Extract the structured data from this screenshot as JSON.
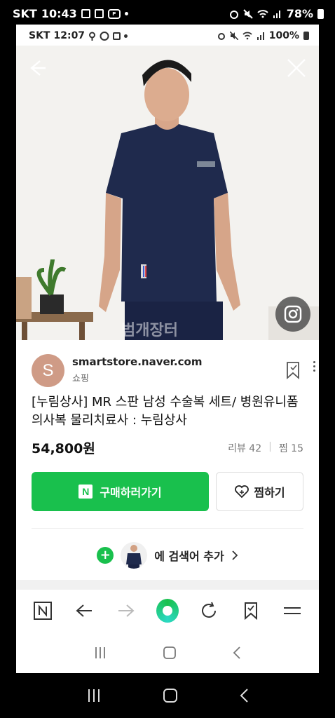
{
  "outer_status": {
    "carrier": "SKT",
    "time": "10:43",
    "battery": "78%"
  },
  "inner_status": {
    "carrier": "SKT",
    "time": "12:07",
    "battery": "100%"
  },
  "photo": {
    "watermark": "범개장터"
  },
  "seller": {
    "avatar_letter": "S",
    "domain": "smartstore.naver.com",
    "category": "쇼핑"
  },
  "product": {
    "title": "[누림상사] MR 스판 남성 수술복 세트/ 병원유니폼 의사복 물리치료사 : 누림상사",
    "price": "54,800원",
    "reviews": "리뷰 42",
    "wishes": "찜 15"
  },
  "actions": {
    "buy_badge": "N",
    "buy_label": "구매하러가기",
    "wish_label": "찜하기"
  },
  "add_search": {
    "label": "에 검색어 추가"
  },
  "colors": {
    "accent": "#19c04d",
    "avatar": "#cf9b86"
  }
}
